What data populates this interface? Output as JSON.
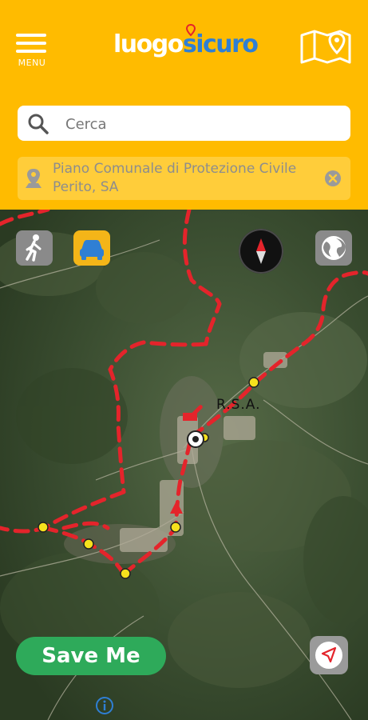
{
  "header": {
    "menu_label": "MENU",
    "logo_part1": "luogo",
    "logo_part2": "sicuro",
    "menu_icon": "hamburger-icon",
    "map_icon": "map-pin-icon"
  },
  "search": {
    "placeholder": "Cerca",
    "icon": "search-icon"
  },
  "location": {
    "label": "Piano Comunale di Protezione Civile Perito, SA",
    "icon": "location-pin-icon",
    "clear_icon": "close-icon"
  },
  "map": {
    "label_rsa": "R.S.A.",
    "controls": {
      "walk_icon": "walk-icon",
      "car_icon": "car-icon",
      "compass_icon": "compass-icon",
      "globe_icon": "globe-icon",
      "locate_icon": "navigation-arrow-icon",
      "info_icon": "info-icon"
    }
  },
  "actions": {
    "save_me": "Save Me"
  },
  "colors": {
    "header": "#ffbb00",
    "location_bar": "#ffcd3a",
    "save_button": "#2eaa5a",
    "route": "#e4242b",
    "logo_blue": "#2f7fd4"
  }
}
